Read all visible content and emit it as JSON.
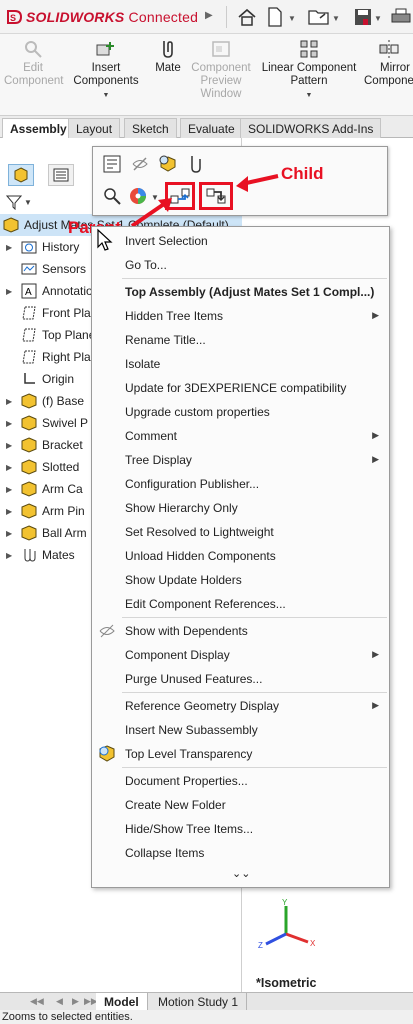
{
  "app": {
    "logo": "3S",
    "brand": "SOLIDWORKS",
    "suffix": "Connected"
  },
  "command_manager": [
    {
      "label": "Edit Component",
      "disabled": true,
      "icon": "edit-component-icon"
    },
    {
      "label": "Insert Components",
      "disabled": false,
      "icon": "insert-components-icon",
      "dropdown": true
    },
    {
      "label": "Mate",
      "disabled": false,
      "icon": "mate-icon"
    },
    {
      "label": "Component Preview Window",
      "disabled": true,
      "icon": "preview-window-icon"
    },
    {
      "label": "Linear Component Pattern",
      "disabled": false,
      "icon": "linear-pattern-icon",
      "dropdown": true
    },
    {
      "label": "Mirror Components",
      "disabled": false,
      "icon": "mirror-components-icon"
    }
  ],
  "tabs": [
    "Assembly",
    "Layout",
    "Sketch",
    "Evaluate",
    "SOLIDWORKS Add-Ins"
  ],
  "tree": {
    "root": "Adjust Mates Set 1 Complete (Default)",
    "items": [
      {
        "label": "History",
        "icon": "history-icon",
        "expand": true
      },
      {
        "label": "Sensors",
        "icon": "sensors-icon",
        "expand": false
      },
      {
        "label": "Annotations",
        "icon": "annotations-icon",
        "expand": true
      },
      {
        "label": "Front Plane",
        "icon": "plane-icon",
        "expand": false
      },
      {
        "label": "Top Plane",
        "icon": "plane-icon",
        "expand": false
      },
      {
        "label": "Right Plane",
        "icon": "plane-icon",
        "expand": false
      },
      {
        "label": "Origin",
        "icon": "origin-icon",
        "expand": false
      },
      {
        "label": "(f) Base",
        "icon": "part-icon",
        "expand": true
      },
      {
        "label": "Swivel P",
        "icon": "part-icon",
        "expand": true
      },
      {
        "label": "Bracket",
        "icon": "part-icon",
        "expand": true
      },
      {
        "label": "Slotted",
        "icon": "part-icon",
        "expand": true
      },
      {
        "label": "Arm Ca",
        "icon": "part-icon",
        "expand": true
      },
      {
        "label": "Arm Pin",
        "icon": "part-icon",
        "expand": true
      },
      {
        "label": "Ball Arm",
        "icon": "part-icon",
        "expand": true
      },
      {
        "label": "Mates",
        "icon": "mates-icon",
        "expand": true
      }
    ]
  },
  "annotations": {
    "child": "Child",
    "parent": "Parent"
  },
  "menu": {
    "items": [
      {
        "label": "Invert Selection"
      },
      {
        "label": "Go To..."
      },
      {
        "sep": true
      },
      {
        "label": "Top Assembly (Adjust Mates Set 1 Compl...)",
        "header": true
      },
      {
        "label": "Hidden Tree Items",
        "sub": true
      },
      {
        "label": "Rename Title..."
      },
      {
        "label": "Isolate"
      },
      {
        "label": "Update for 3DEXPERIENCE compatibility"
      },
      {
        "label": "Upgrade custom properties"
      },
      {
        "label": "Comment",
        "sub": true
      },
      {
        "label": "Tree Display",
        "sub": true
      },
      {
        "label": "Configuration Publisher..."
      },
      {
        "label": "Show Hierarchy Only"
      },
      {
        "label": "Set Resolved to Lightweight"
      },
      {
        "label": "Unload Hidden Components"
      },
      {
        "label": "Show Update Holders"
      },
      {
        "label": "Edit Component References..."
      },
      {
        "sep": true
      },
      {
        "label": "Show with Dependents",
        "icon": "show-dependents-icon"
      },
      {
        "label": "Component Display",
        "sub": true
      },
      {
        "label": "Purge Unused Features..."
      },
      {
        "sep": true
      },
      {
        "label": "Reference Geometry Display",
        "sub": true
      },
      {
        "label": "Insert New Subassembly"
      },
      {
        "label": "Top Level Transparency",
        "icon": "transparency-icon"
      },
      {
        "sep": true
      },
      {
        "label": "Document Properties..."
      },
      {
        "label": "Create New Folder"
      },
      {
        "label": "Hide/Show Tree Items..."
      },
      {
        "label": "Collapse Items"
      }
    ],
    "expand_glyph": "⌄⌄"
  },
  "view": {
    "name": "*Isometric"
  },
  "bottom_tabs": [
    "Model",
    "Motion Study 1"
  ],
  "status": "Zooms to selected entities.",
  "colors": {
    "brand": "#c8102e",
    "annotation": "#e81123",
    "selection": "#cde4f7"
  }
}
